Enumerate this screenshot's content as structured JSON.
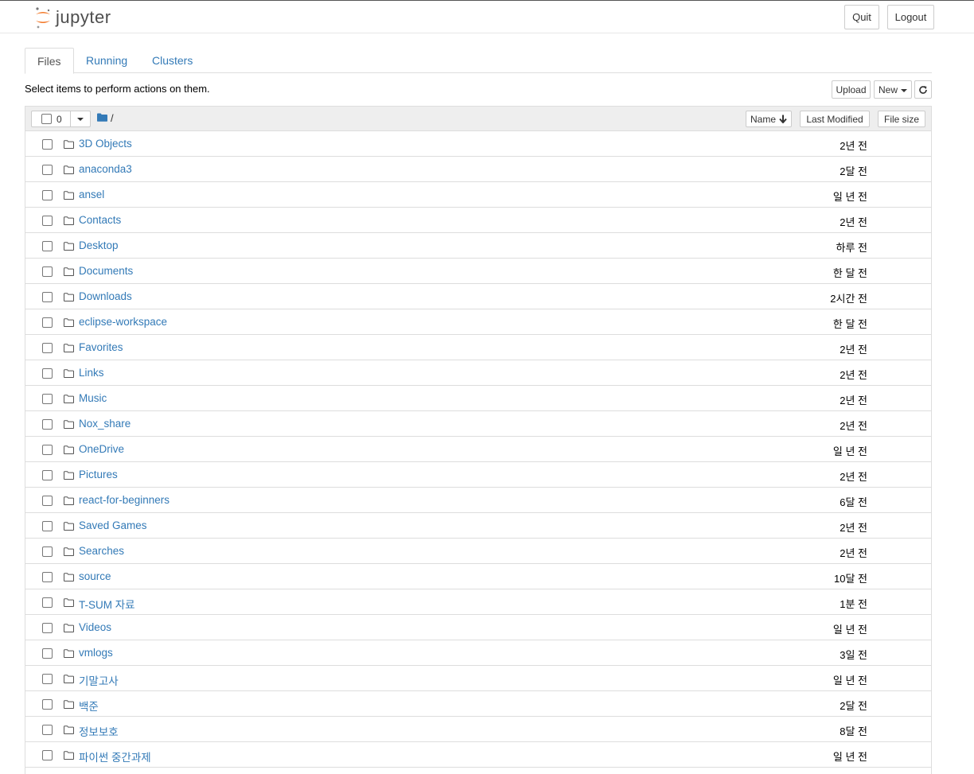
{
  "header": {
    "logo_text": "jupyter",
    "quit_label": "Quit",
    "logout_label": "Logout"
  },
  "tabs": [
    {
      "label": "Files",
      "active": true
    },
    {
      "label": "Running",
      "active": false
    },
    {
      "label": "Clusters",
      "active": false
    }
  ],
  "toolbar": {
    "instructions": "Select items to perform actions on them.",
    "upload_label": "Upload",
    "new_label": "New",
    "refresh_icon": "refresh-icon"
  },
  "list_header": {
    "selected_count": "0",
    "breadcrumb": "/",
    "sort_name": "Name",
    "sort_modified": "Last Modified",
    "sort_size": "File size"
  },
  "items": [
    {
      "name": "3D Objects",
      "modified": "2년 전"
    },
    {
      "name": "anaconda3",
      "modified": "2달 전"
    },
    {
      "name": "ansel",
      "modified": "일 년 전"
    },
    {
      "name": "Contacts",
      "modified": "2년 전"
    },
    {
      "name": "Desktop",
      "modified": "하루 전"
    },
    {
      "name": "Documents",
      "modified": "한 달 전"
    },
    {
      "name": "Downloads",
      "modified": "2시간 전"
    },
    {
      "name": "eclipse-workspace",
      "modified": "한 달 전"
    },
    {
      "name": "Favorites",
      "modified": "2년 전"
    },
    {
      "name": "Links",
      "modified": "2년 전"
    },
    {
      "name": "Music",
      "modified": "2년 전"
    },
    {
      "name": "Nox_share",
      "modified": "2년 전"
    },
    {
      "name": "OneDrive",
      "modified": "일 년 전"
    },
    {
      "name": "Pictures",
      "modified": "2년 전"
    },
    {
      "name": "react-for-beginners",
      "modified": "6달 전"
    },
    {
      "name": "Saved Games",
      "modified": "2년 전"
    },
    {
      "name": "Searches",
      "modified": "2년 전"
    },
    {
      "name": "source",
      "modified": "10달 전"
    },
    {
      "name": "T-SUM 자료",
      "modified": "1분 전"
    },
    {
      "name": "Videos",
      "modified": "일 년 전"
    },
    {
      "name": "vmlogs",
      "modified": "3일 전"
    },
    {
      "name": "기말고사",
      "modified": "일 년 전"
    },
    {
      "name": "백준",
      "modified": "2달 전"
    },
    {
      "name": "정보보호",
      "modified": "8달 전"
    },
    {
      "name": "파이썬 중간과제",
      "modified": "일 년 전"
    }
  ],
  "colors": {
    "link": "#337ab7",
    "logo_orange": "#f37726"
  }
}
